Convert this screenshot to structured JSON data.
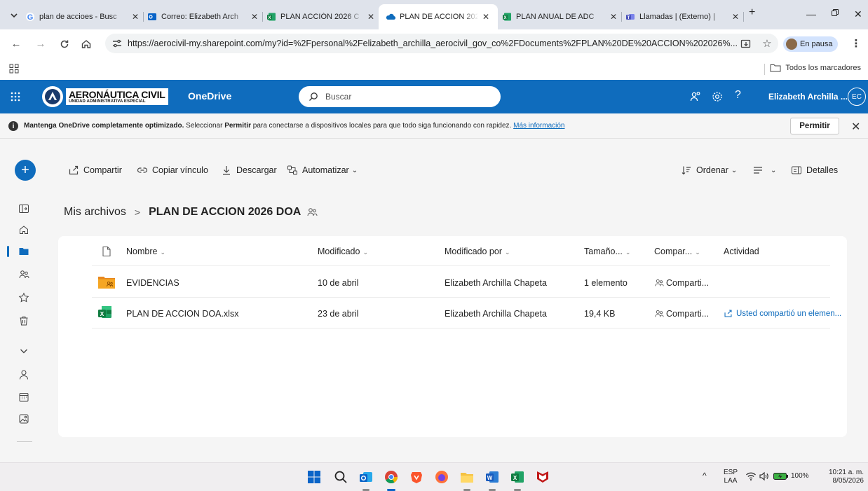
{
  "browser": {
    "tabs": [
      {
        "title": "plan de accioes - Busc",
        "favicon": "google-icon"
      },
      {
        "title": "Correo: Elizabeth Arch",
        "favicon": "outlook-icon"
      },
      {
        "title": "PLAN ACCIÓN 2026 C",
        "favicon": "excel-icon"
      },
      {
        "title": "PLAN DE ACCION 202",
        "favicon": "onedrive-icon",
        "active": true
      },
      {
        "title": "PLAN ANUAL DE ADC",
        "favicon": "excel-icon"
      },
      {
        "title": "Llamadas | (Externo) |",
        "favicon": "teams-icon"
      }
    ],
    "url": "https://aerocivil-my.sharepoint.com/my?id=%2Fpersonal%2Felizabeth_archilla_aerocivil_gov_co%2FDocuments%2FPLAN%20DE%20ACCION%202026%...",
    "profile_status": "En pausa",
    "bookmarks_all": "Todos los marcadores"
  },
  "suite": {
    "brand_name": "AERONÁUTICA CIVIL",
    "brand_sub": "UNIDAD ADMINISTRATIVA ESPECIAL",
    "app_name": "OneDrive",
    "search_placeholder": "Buscar",
    "help_glyph": "?",
    "user_name": "Elizabeth Archilla ...",
    "user_initials": "EC"
  },
  "banner": {
    "lead": "Mantenga OneDrive completamente optimizado.",
    "text_before": " Seleccionar ",
    "bold_word": "Permitir",
    "text_after": " para conectarse a dispositivos locales para que todo siga funcionando con rapidez. ",
    "link": "Más información",
    "button": "Permitir",
    "info_glyph": "i",
    "close_glyph": "✕"
  },
  "commands": {
    "new_glyph": "+",
    "share": "Compartir",
    "copy_link": "Copiar vínculo",
    "download": "Descargar",
    "automate": "Automatizar",
    "sort": "Ordenar",
    "details": "Detalles",
    "chevron": "⌄"
  },
  "breadcrumb": {
    "root": "Mis archivos",
    "separator": ">",
    "current": "PLAN DE ACCION 2026 DOA"
  },
  "table": {
    "columns": {
      "name": "Nombre",
      "modified": "Modificado",
      "modified_by": "Modificado por",
      "size": "Tamaño...",
      "sharing": "Compar...",
      "activity": "Actividad"
    },
    "sort_glyph": "⌄",
    "rows": [
      {
        "type": "folder",
        "name": "EVIDENCIAS",
        "modified": "10 de abril",
        "modified_by": "Elizabeth Archilla Chapeta",
        "size": "1 elemento",
        "sharing": "Comparti...",
        "activity": ""
      },
      {
        "type": "excel",
        "name": "PLAN DE ACCION DOA.xlsx",
        "modified": "23 de abril",
        "modified_by": "Elizabeth Archilla Chapeta",
        "size": "19,4 KB",
        "sharing": "Comparti...",
        "activity": "Usted compartió un elemen..."
      }
    ]
  },
  "taskbar": {
    "lang_top": "ESP",
    "lang_bottom": "LAA",
    "battery": "100%",
    "time": "10:21 a. m.",
    "date": "8/05/2026"
  },
  "colors": {
    "suite_blue": "#0f6cbd",
    "tab_strip": "#dfe3eb",
    "body_bg": "#f5f5f5"
  }
}
